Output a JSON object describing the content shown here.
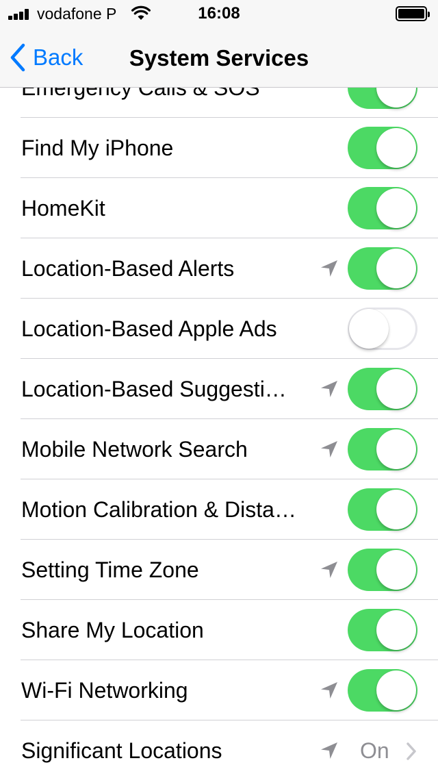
{
  "status_bar": {
    "carrier": "vodafone P",
    "time": "16:08"
  },
  "nav": {
    "back_label": "Back",
    "title": "System Services"
  },
  "colors": {
    "accent": "#007aff",
    "toggle_on": "#4cd964",
    "secondary_text": "#8e8e93"
  },
  "rows": [
    {
      "label": "Emergency Calls & SOS",
      "location_icon": false,
      "toggle": "on"
    },
    {
      "label": "Find My iPhone",
      "location_icon": false,
      "toggle": "on"
    },
    {
      "label": "HomeKit",
      "location_icon": false,
      "toggle": "on"
    },
    {
      "label": "Location-Based Alerts",
      "location_icon": true,
      "toggle": "on"
    },
    {
      "label": "Location-Based Apple Ads",
      "location_icon": false,
      "toggle": "off"
    },
    {
      "label": "Location-Based Suggesti…",
      "location_icon": true,
      "toggle": "on"
    },
    {
      "label": "Mobile Network Search",
      "location_icon": true,
      "toggle": "on"
    },
    {
      "label": "Motion Calibration & Dista…",
      "location_icon": false,
      "toggle": "on"
    },
    {
      "label": "Setting Time Zone",
      "location_icon": true,
      "toggle": "on"
    },
    {
      "label": "Share My Location",
      "location_icon": false,
      "toggle": "on"
    },
    {
      "label": "Wi-Fi Networking",
      "location_icon": true,
      "toggle": "on"
    },
    {
      "label": "Significant Locations",
      "location_icon": true,
      "value": "On",
      "disclosure": "chevron-right-icon"
    }
  ]
}
